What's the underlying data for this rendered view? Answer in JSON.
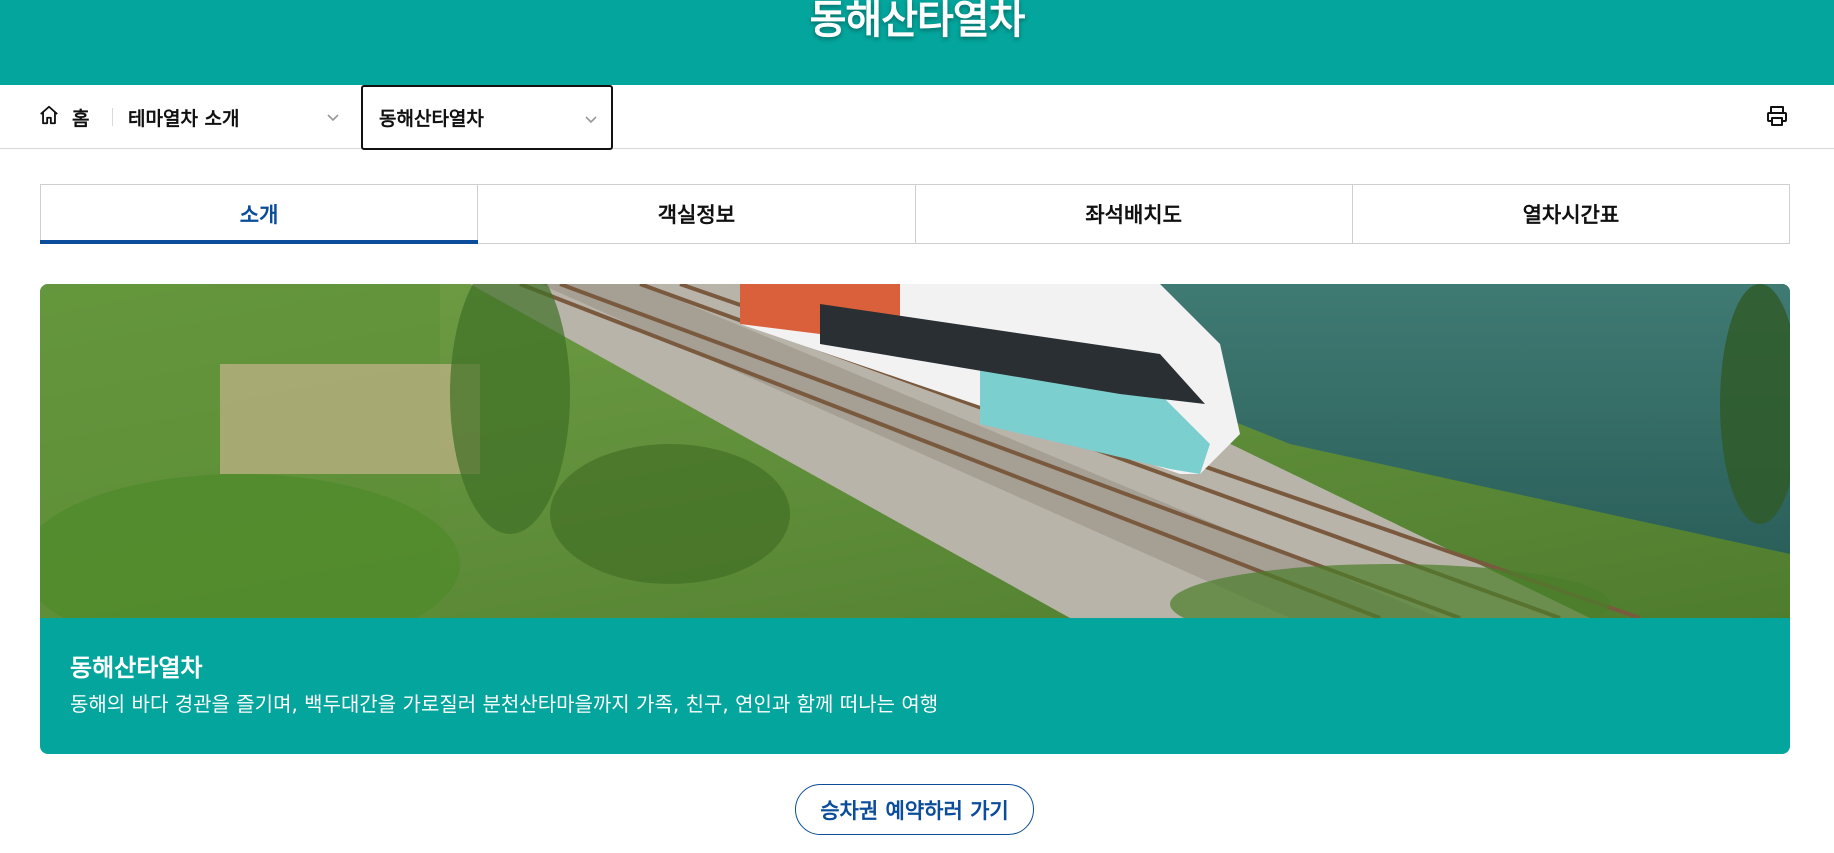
{
  "header": {
    "title": "동해산타열차"
  },
  "location": {
    "home_label": "홈",
    "level1": "테마열차 소개",
    "level2": "동해산타열차"
  },
  "tabs": [
    {
      "label": "소개",
      "active": true
    },
    {
      "label": "객실정보",
      "active": false
    },
    {
      "label": "좌석배치도",
      "active": false
    },
    {
      "label": "열차시간표",
      "active": false
    }
  ],
  "card": {
    "title": "동해산타열차",
    "description": "동해의 바다 경관을 즐기며, 백두대간을 가로질러 분천산타마을까지 가족, 친구, 연인과 함께 떠나는 여행"
  },
  "cta": {
    "label": "승차권 예약하러 가기"
  },
  "colors": {
    "teal": "#03a59c",
    "navy": "#0b4d9b"
  }
}
